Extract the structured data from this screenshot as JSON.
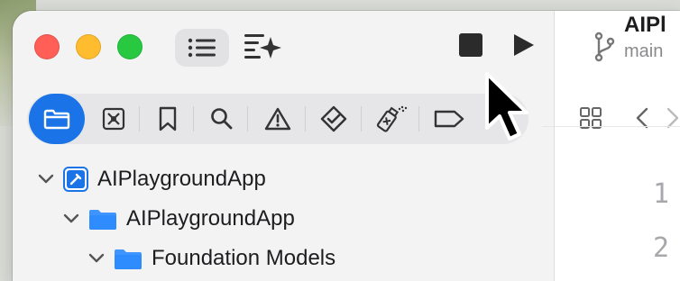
{
  "window": {
    "title": "AIPl",
    "branch": "main"
  },
  "toolbar": {
    "navigator_toggle": "sidebar-list-icon",
    "assistant": "sparkle-icon",
    "stop": "stop-icon",
    "run": "play-icon"
  },
  "navigators": [
    {
      "name": "folder-icon",
      "selected": true
    },
    {
      "name": "source-control-icon"
    },
    {
      "name": "bookmark-icon"
    },
    {
      "name": "magnifier-icon"
    },
    {
      "name": "warning-icon"
    },
    {
      "name": "test-diamond-icon"
    },
    {
      "name": "debug-spray-icon"
    },
    {
      "name": "tag-icon"
    }
  ],
  "tree": [
    {
      "label": "AIPlaygroundApp",
      "kind": "project",
      "level": 0
    },
    {
      "label": "AIPlaygroundApp",
      "kind": "folder",
      "level": 1
    },
    {
      "label": "Foundation Models",
      "kind": "folder",
      "level": 2
    }
  ],
  "editor": {
    "line_numbers": [
      "1",
      "2"
    ]
  },
  "colors": {
    "accent": "#1a74e8",
    "folder": "#2f8cff"
  }
}
